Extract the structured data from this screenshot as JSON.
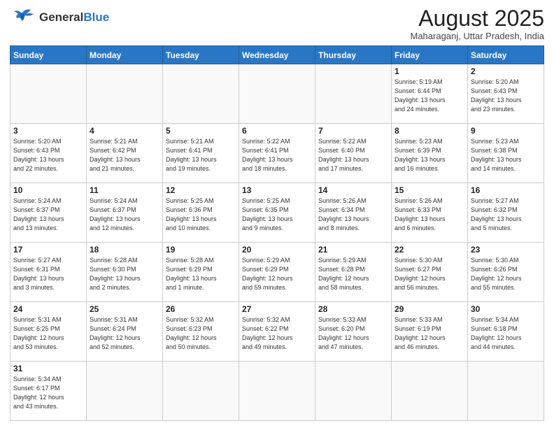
{
  "header": {
    "logo_general": "General",
    "logo_blue": "Blue",
    "month_title": "August 2025",
    "subtitle": "Maharaganj, Uttar Pradesh, India"
  },
  "weekdays": [
    "Sunday",
    "Monday",
    "Tuesday",
    "Wednesday",
    "Thursday",
    "Friday",
    "Saturday"
  ],
  "weeks": [
    [
      {
        "day": "",
        "info": ""
      },
      {
        "day": "",
        "info": ""
      },
      {
        "day": "",
        "info": ""
      },
      {
        "day": "",
        "info": ""
      },
      {
        "day": "",
        "info": ""
      },
      {
        "day": "1",
        "info": "Sunrise: 5:19 AM\nSunset: 6:44 PM\nDaylight: 13 hours\nand 24 minutes."
      },
      {
        "day": "2",
        "info": "Sunrise: 5:20 AM\nSunset: 6:43 PM\nDaylight: 13 hours\nand 23 minutes."
      }
    ],
    [
      {
        "day": "3",
        "info": "Sunrise: 5:20 AM\nSunset: 6:43 PM\nDaylight: 13 hours\nand 22 minutes."
      },
      {
        "day": "4",
        "info": "Sunrise: 5:21 AM\nSunset: 6:42 PM\nDaylight: 13 hours\nand 21 minutes."
      },
      {
        "day": "5",
        "info": "Sunrise: 5:21 AM\nSunset: 6:41 PM\nDaylight: 13 hours\nand 19 minutes."
      },
      {
        "day": "6",
        "info": "Sunrise: 5:22 AM\nSunset: 6:41 PM\nDaylight: 13 hours\nand 18 minutes."
      },
      {
        "day": "7",
        "info": "Sunrise: 5:22 AM\nSunset: 6:40 PM\nDaylight: 13 hours\nand 17 minutes."
      },
      {
        "day": "8",
        "info": "Sunrise: 5:23 AM\nSunset: 6:39 PM\nDaylight: 13 hours\nand 16 minutes."
      },
      {
        "day": "9",
        "info": "Sunrise: 5:23 AM\nSunset: 6:38 PM\nDaylight: 13 hours\nand 14 minutes."
      }
    ],
    [
      {
        "day": "10",
        "info": "Sunrise: 5:24 AM\nSunset: 6:37 PM\nDaylight: 13 hours\nand 13 minutes."
      },
      {
        "day": "11",
        "info": "Sunrise: 5:24 AM\nSunset: 6:37 PM\nDaylight: 13 hours\nand 12 minutes."
      },
      {
        "day": "12",
        "info": "Sunrise: 5:25 AM\nSunset: 6:36 PM\nDaylight: 13 hours\nand 10 minutes."
      },
      {
        "day": "13",
        "info": "Sunrise: 5:25 AM\nSunset: 6:35 PM\nDaylight: 13 hours\nand 9 minutes."
      },
      {
        "day": "14",
        "info": "Sunrise: 5:26 AM\nSunset: 6:34 PM\nDaylight: 13 hours\nand 8 minutes."
      },
      {
        "day": "15",
        "info": "Sunrise: 5:26 AM\nSunset: 6:33 PM\nDaylight: 13 hours\nand 6 minutes."
      },
      {
        "day": "16",
        "info": "Sunrise: 5:27 AM\nSunset: 6:32 PM\nDaylight: 13 hours\nand 5 minutes."
      }
    ],
    [
      {
        "day": "17",
        "info": "Sunrise: 5:27 AM\nSunset: 6:31 PM\nDaylight: 13 hours\nand 3 minutes."
      },
      {
        "day": "18",
        "info": "Sunrise: 5:28 AM\nSunset: 6:30 PM\nDaylight: 13 hours\nand 2 minutes."
      },
      {
        "day": "19",
        "info": "Sunrise: 5:28 AM\nSunset: 6:29 PM\nDaylight: 13 hours\nand 1 minute."
      },
      {
        "day": "20",
        "info": "Sunrise: 5:29 AM\nSunset: 6:29 PM\nDaylight: 12 hours\nand 59 minutes."
      },
      {
        "day": "21",
        "info": "Sunrise: 5:29 AM\nSunset: 6:28 PM\nDaylight: 12 hours\nand 58 minutes."
      },
      {
        "day": "22",
        "info": "Sunrise: 5:30 AM\nSunset: 6:27 PM\nDaylight: 12 hours\nand 56 minutes."
      },
      {
        "day": "23",
        "info": "Sunrise: 5:30 AM\nSunset: 6:26 PM\nDaylight: 12 hours\nand 55 minutes."
      }
    ],
    [
      {
        "day": "24",
        "info": "Sunrise: 5:31 AM\nSunset: 6:25 PM\nDaylight: 12 hours\nand 53 minutes."
      },
      {
        "day": "25",
        "info": "Sunrise: 5:31 AM\nSunset: 6:24 PM\nDaylight: 12 hours\nand 52 minutes."
      },
      {
        "day": "26",
        "info": "Sunrise: 5:32 AM\nSunset: 6:23 PM\nDaylight: 12 hours\nand 50 minutes."
      },
      {
        "day": "27",
        "info": "Sunrise: 5:32 AM\nSunset: 6:22 PM\nDaylight: 12 hours\nand 49 minutes."
      },
      {
        "day": "28",
        "info": "Sunrise: 5:33 AM\nSunset: 6:20 PM\nDaylight: 12 hours\nand 47 minutes."
      },
      {
        "day": "29",
        "info": "Sunrise: 5:33 AM\nSunset: 6:19 PM\nDaylight: 12 hours\nand 46 minutes."
      },
      {
        "day": "30",
        "info": "Sunrise: 5:34 AM\nSunset: 6:18 PM\nDaylight: 12 hours\nand 44 minutes."
      }
    ],
    [
      {
        "day": "31",
        "info": "Sunrise: 5:34 AM\nSunset: 6:17 PM\nDaylight: 12 hours\nand 43 minutes."
      },
      {
        "day": "",
        "info": ""
      },
      {
        "day": "",
        "info": ""
      },
      {
        "day": "",
        "info": ""
      },
      {
        "day": "",
        "info": ""
      },
      {
        "day": "",
        "info": ""
      },
      {
        "day": "",
        "info": ""
      }
    ]
  ]
}
